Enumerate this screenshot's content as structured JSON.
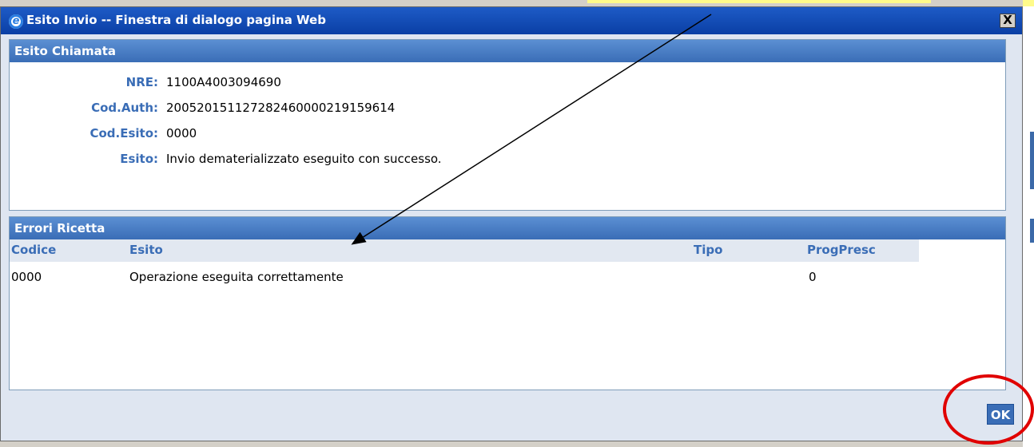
{
  "window": {
    "title": "Esito Invio -- Finestra di dialogo pagina Web",
    "close_label": "X"
  },
  "esito_chiamata": {
    "header": "Esito Chiamata",
    "fields": [
      {
        "label": "NRE:",
        "value": "1100A4003094690"
      },
      {
        "label": "Cod.Auth:",
        "value": "200520151127282460000219159614"
      },
      {
        "label": "Cod.Esito:",
        "value": "0000"
      },
      {
        "label": "Esito:",
        "value": "Invio dematerializzato eseguito con successo."
      }
    ]
  },
  "errori_ricetta": {
    "header": "Errori Ricetta",
    "columns": [
      "Codice",
      "Esito",
      "Tipo",
      "ProgPresc"
    ],
    "rows": [
      {
        "codice": "0000",
        "esito": "Operazione eseguita correttamente",
        "tipo": "",
        "progpresc": "0"
      }
    ]
  },
  "footer": {
    "ok_label": "OK"
  },
  "annotation_colors": {
    "arrow": "#000000",
    "circle": "#e00000"
  }
}
